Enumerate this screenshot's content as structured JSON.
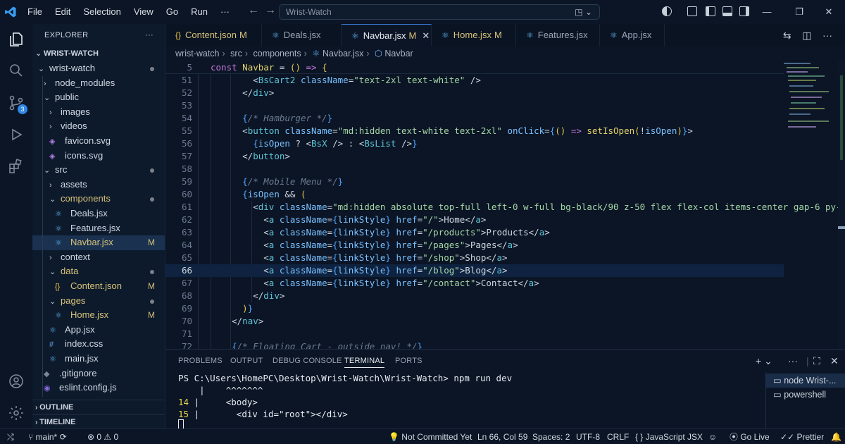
{
  "titlebar": {
    "menu": [
      "File",
      "Edit",
      "Selection",
      "View",
      "Go",
      "Run",
      "···"
    ],
    "search_placeholder": "Wrist-Watch"
  },
  "sidebar": {
    "title": "EXPLORER",
    "root": "WRIST-WATCH",
    "items": [
      {
        "label": "wrist-watch",
        "type": "folder-open",
        "depth": 1,
        "dot": true
      },
      {
        "label": "node_modules",
        "type": "folder",
        "depth": 2
      },
      {
        "label": "public",
        "type": "folder-open",
        "depth": 2
      },
      {
        "label": "images",
        "type": "folder",
        "depth": 3
      },
      {
        "label": "videos",
        "type": "folder",
        "depth": 3
      },
      {
        "label": "favicon.svg",
        "type": "svg",
        "depth": 3
      },
      {
        "label": "icons.svg",
        "type": "svg",
        "depth": 3
      },
      {
        "label": "src",
        "type": "folder-open",
        "depth": 2,
        "dot": true
      },
      {
        "label": "assets",
        "type": "folder",
        "depth": 3
      },
      {
        "label": "components",
        "type": "folder-open",
        "depth": 3,
        "dot": true,
        "accent": true
      },
      {
        "label": "Deals.jsx",
        "type": "react",
        "depth": 4
      },
      {
        "label": "Features.jsx",
        "type": "react",
        "depth": 4
      },
      {
        "label": "Navbar.jsx",
        "type": "react",
        "depth": 4,
        "mod": "M",
        "selected": true
      },
      {
        "label": "context",
        "type": "folder",
        "depth": 3
      },
      {
        "label": "data",
        "type": "folder-open",
        "depth": 3,
        "dot": true,
        "accent": true
      },
      {
        "label": "Content.json",
        "type": "json",
        "depth": 4,
        "mod": "M"
      },
      {
        "label": "pages",
        "type": "folder-open",
        "depth": 3,
        "dot": true,
        "accent": true
      },
      {
        "label": "Home.jsx",
        "type": "react",
        "depth": 4,
        "mod": "M"
      },
      {
        "label": "App.jsx",
        "type": "react",
        "depth": 3
      },
      {
        "label": "index.css",
        "type": "css",
        "depth": 3
      },
      {
        "label": "main.jsx",
        "type": "react",
        "depth": 3
      },
      {
        "label": ".gitignore",
        "type": "git",
        "depth": 2
      },
      {
        "label": "eslint.config.js",
        "type": "eslint",
        "depth": 2
      }
    ],
    "outline": "OUTLINE",
    "timeline": "TIMELINE"
  },
  "tabs": [
    {
      "label": "Content.json",
      "icon": "{}",
      "mod": "M"
    },
    {
      "label": "Deals.jsx",
      "icon": "⚛"
    },
    {
      "label": "Navbar.jsx",
      "icon": "⚛",
      "mod": "M",
      "active": true
    },
    {
      "label": "Home.jsx",
      "icon": "⚛",
      "mod": "M"
    },
    {
      "label": "Features.jsx",
      "icon": "⚛"
    },
    {
      "label": "App.jsx",
      "icon": "⚛"
    }
  ],
  "breadcrumb": [
    "wrist-watch",
    "src",
    "components",
    "Navbar.jsx",
    "Navbar"
  ],
  "editor": {
    "lines": [
      {
        "n": "5",
        "sticky": true
      },
      {
        "n": "51"
      },
      {
        "n": "52"
      },
      {
        "n": "53"
      },
      {
        "n": "54"
      },
      {
        "n": "55"
      },
      {
        "n": "56"
      },
      {
        "n": "57"
      },
      {
        "n": "58"
      },
      {
        "n": "59"
      },
      {
        "n": "60"
      },
      {
        "n": "61"
      },
      {
        "n": "62"
      },
      {
        "n": "63"
      },
      {
        "n": "64"
      },
      {
        "n": "65"
      },
      {
        "n": "66",
        "current": true
      },
      {
        "n": "67"
      },
      {
        "n": "68"
      },
      {
        "n": "69"
      },
      {
        "n": "70"
      },
      {
        "n": "71"
      },
      {
        "n": "72"
      }
    ]
  },
  "panel": {
    "tabs": [
      "PROBLEMS",
      "OUTPUT",
      "DEBUG CONSOLE",
      "TERMINAL",
      "PORTS"
    ],
    "active_tab": "TERMINAL",
    "terminal_lines": [
      {
        "ln": "",
        "text": "PS C:\\Users\\HomePC\\Desktop\\Wrist-Watch\\Wrist-Watch> npm run dev"
      },
      {
        "ln": "",
        "text": "    |    ^^^^^^^"
      },
      {
        "ln": "14",
        "text": " |     <body>"
      },
      {
        "ln": "15",
        "text": " |       <div id=\"root\"></div>"
      }
    ],
    "terminals": [
      "node  Wrist-...",
      "powershell"
    ]
  },
  "statusbar": {
    "branch": "main*",
    "errors": "0",
    "warnings": "0",
    "git_status": "Not Committed Yet",
    "position": "Ln 66, Col 59",
    "spaces": "Spaces: 2",
    "encoding": "UTF-8",
    "eol": "CRLF",
    "language": "JavaScript JSX",
    "golive": "Go Live",
    "prettier": "Prettier"
  },
  "colors": {
    "background": "#0b1525",
    "accent": "#2f87e6",
    "modified": "#d7c27a"
  }
}
